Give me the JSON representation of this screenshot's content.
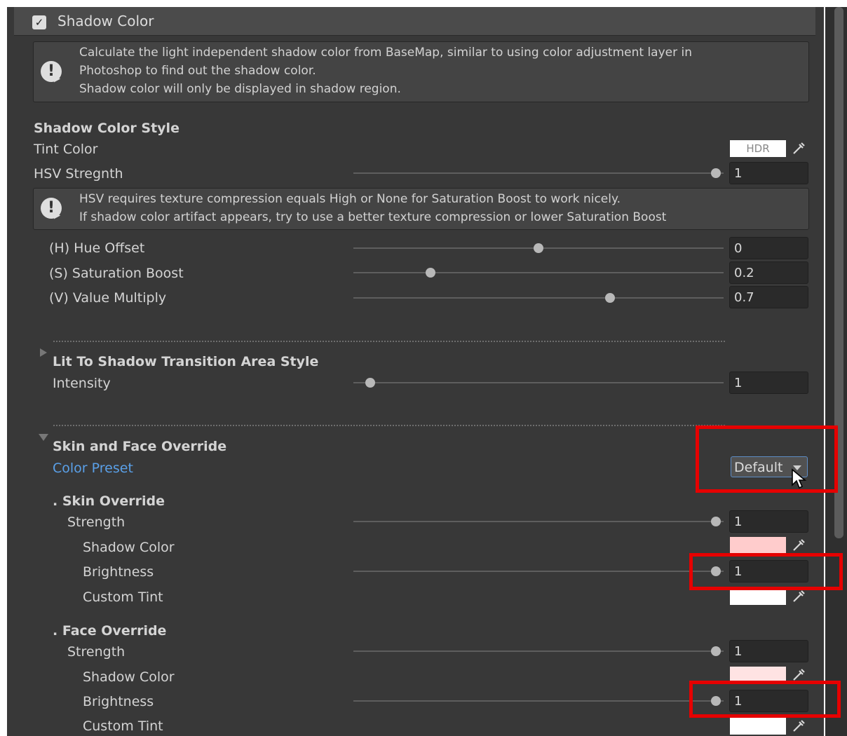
{
  "header": {
    "checkbox_mark": "✓",
    "title": "Shadow Color"
  },
  "help1": {
    "text": "Calculate the light independent shadow color from BaseMap, similar to using color adjustment layer in\nPhotoshop to find out the shadow color.\nShadow color will only be displayed in shadow region."
  },
  "help2": {
    "text": "HSV requires texture compression equals High or None for Saturation Boost to work nicely.\nIf shadow color artifact appears, try to use a better texture compression or lower Saturation Boost"
  },
  "help_icon_glyph": "!",
  "shadow_color_style": {
    "title": "Shadow Color Style",
    "tint_color_label": "Tint Color",
    "tint_hdr_label": "HDR",
    "hsv_strength_label": "HSV Stregnth",
    "hsv_strength_value": "1",
    "hue_offset_label": "(H) Hue Offset",
    "hue_offset_value": "0",
    "saturation_label": "(S) Saturation Boost",
    "saturation_value": "0.2",
    "value_multiply_label": "(V) Value Multiply",
    "value_multiply_value": "0.7"
  },
  "transition": {
    "title": "Lit To Shadow Transition Area Style",
    "intensity_label": "Intensity",
    "intensity_value": "1"
  },
  "skin_face": {
    "title": "Skin and Face Override",
    "color_preset_label": "Color Preset",
    "dropdown_value": "Default",
    "skin": {
      "title": ". Skin Override",
      "strength_label": "Strength",
      "strength_value": "1",
      "shadow_color_label": "Shadow Color",
      "shadow_color": "#ffcccc",
      "brightness_label": "Brightness",
      "brightness_value": "1",
      "custom_tint_label": "Custom Tint",
      "custom_tint_color": "#ffffff"
    },
    "face": {
      "title": ". Face Override",
      "strength_label": "Strength",
      "strength_value": "1",
      "shadow_color_label": "Shadow Color",
      "shadow_color": "#ffe3e3",
      "brightness_label": "Brightness",
      "brightness_value": "1",
      "custom_tint_label": "Custom Tint",
      "custom_tint_color": "#ffffff"
    }
  },
  "colors": {
    "panel_bg": "#383838",
    "highlight_red": "#e60000",
    "link_blue": "#5aa0e8"
  },
  "icons": {
    "eyedropper": "eyedropper-icon",
    "warning": "warning-icon",
    "checkbox": "checkbox-icon"
  }
}
